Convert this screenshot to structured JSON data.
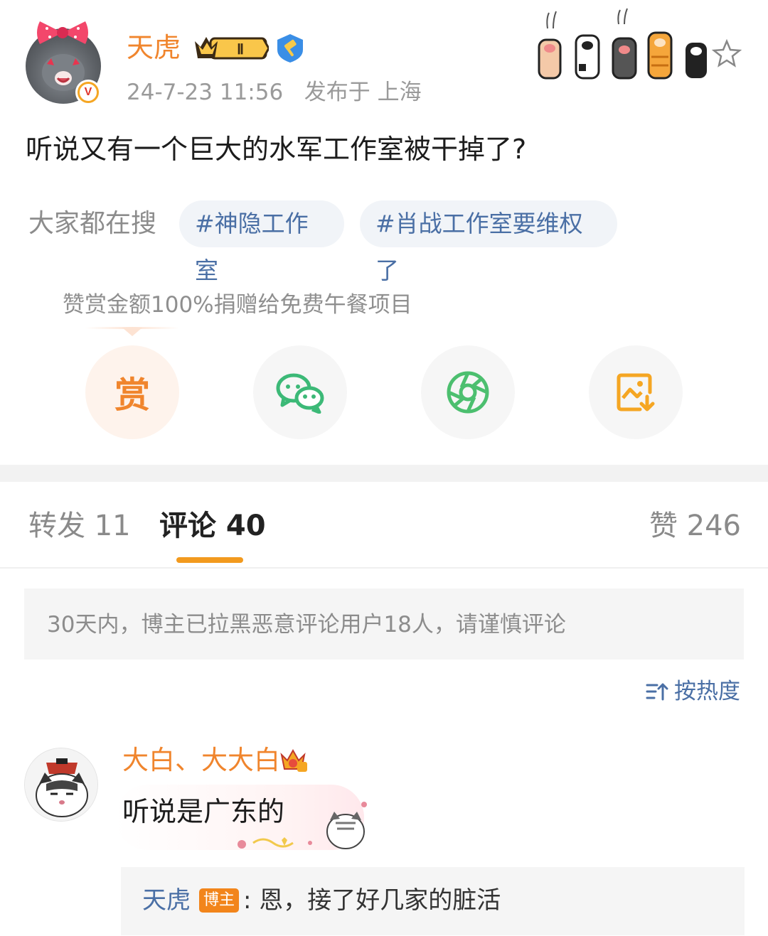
{
  "post": {
    "author": "天虎",
    "level_label": "Ⅱ",
    "verified_mark": "V",
    "timestamp": "24-7-23 11:56",
    "location": "发布于 上海",
    "content": "听说又有一个巨大的水军工作室被干掉了?"
  },
  "trending": {
    "label": "大家都在搜",
    "tags": [
      "#神隐工作室",
      "#肖战工作室要维权了"
    ]
  },
  "reward": {
    "tip": "赞赏金额100%捐赠给免费午餐项目",
    "button_glyph": "赏"
  },
  "share_buttons": {
    "icons": [
      "reward-icon",
      "wechat-icon",
      "moments-icon",
      "save-image-icon"
    ]
  },
  "tabs": {
    "repost": "转发 11",
    "comments": "评论 40",
    "likes": "赞 246"
  },
  "notice": "30天内，博主已拉黑恶意评论用户18人，请谨慎评论",
  "sort": {
    "label": "按热度",
    "icon": "sort-icon"
  },
  "comment": {
    "user": "大白、大大白",
    "text": "听说是广东的",
    "reply": {
      "user": "天虎",
      "badge": "博主",
      "text": ": 恩，接了好几家的脏活"
    }
  },
  "colors": {
    "brand_orange": "#f0852d",
    "link_blue": "#4a6fa5",
    "tab_underline": "#f29a1e",
    "wechat_green": "#3cb977"
  }
}
